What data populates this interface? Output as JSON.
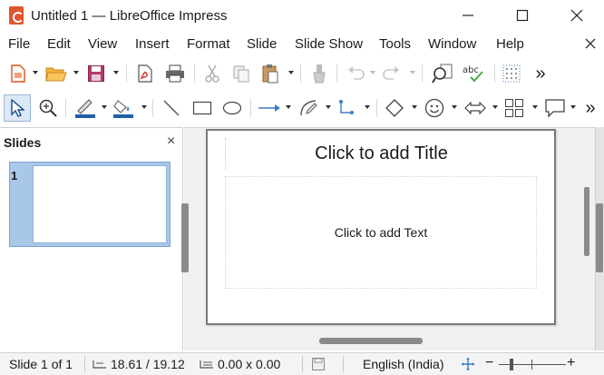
{
  "window": {
    "title": "Untitled 1 — LibreOffice Impress",
    "app_icon": "impress-app-icon",
    "controls": [
      "minimize-icon",
      "maximize-icon",
      "close-icon"
    ]
  },
  "menubar": {
    "items": [
      "File",
      "Edit",
      "View",
      "Insert",
      "Format",
      "Slide",
      "Slide Show",
      "Tools",
      "Window",
      "Help"
    ]
  },
  "toolbar_standard": {
    "icons": [
      "new-document-icon",
      "open-folder-icon",
      "save-icon",
      "export-pdf-icon",
      "print-icon",
      "cut-icon",
      "copy-icon",
      "paste-icon",
      "clone-formatting-icon",
      "undo-icon",
      "redo-icon",
      "find-replace-icon",
      "spelling-icon",
      "grid-icon",
      "more-icon"
    ],
    "more_label": "»"
  },
  "toolbar_drawing": {
    "icons": [
      "select-icon",
      "zoom-pan-icon",
      "line-color-icon",
      "fill-color-icon",
      "line-icon",
      "rectangle-icon",
      "ellipse-icon",
      "line-arrow-icon",
      "curve-icon",
      "connector-icon",
      "basic-shapes-icon",
      "symbol-shapes-icon",
      "block-arrows-icon",
      "flowchart-icon",
      "callout-icon",
      "more-icon"
    ],
    "more_label": "»"
  },
  "slides_panel": {
    "title": "Slides",
    "close_label": "×",
    "thumbnails": [
      {
        "number": "1"
      }
    ]
  },
  "slide": {
    "title_placeholder": "Click to add Title",
    "body_placeholder": "Click to add Text"
  },
  "statusbar": {
    "slide_info": "Slide 1 of 1",
    "position": "18.61 / 19.12",
    "size": "0.00 x 0.00",
    "language": "English (India)",
    "zoom_out": "−",
    "zoom_in": "+"
  },
  "colors": {
    "accent_selection": "#a9c8e8",
    "line_color": "#1f5fa8",
    "fill_color": "#1f5fa8",
    "app_icon": "#e0562f"
  }
}
